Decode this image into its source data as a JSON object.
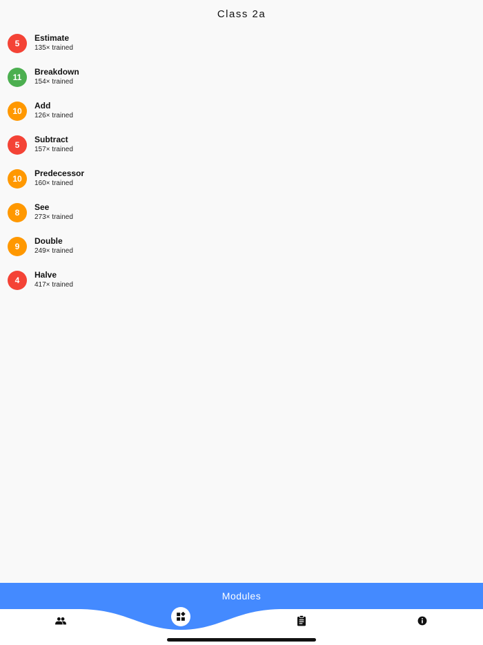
{
  "header": {
    "title": "Class 2a"
  },
  "modules": [
    {
      "badge": "5",
      "color": "#f44336",
      "name": "Estimate",
      "trained": "135× trained"
    },
    {
      "badge": "11",
      "color": "#4caf50",
      "name": "Breakdown",
      "trained": "154× trained"
    },
    {
      "badge": "10",
      "color": "#ff9800",
      "name": "Add",
      "trained": "126× trained"
    },
    {
      "badge": "5",
      "color": "#f44336",
      "name": "Subtract",
      "trained": "157× trained"
    },
    {
      "badge": "10",
      "color": "#ff9800",
      "name": "Predecessor",
      "trained": "160× trained"
    },
    {
      "badge": "8",
      "color": "#ff9800",
      "name": "See",
      "trained": "273× trained"
    },
    {
      "badge": "9",
      "color": "#ff9800",
      "name": "Double",
      "trained": "249× trained"
    },
    {
      "badge": "4",
      "color": "#f44336",
      "name": "Halve",
      "trained": "417× trained"
    }
  ],
  "bottom_nav": {
    "title": "Modules",
    "accent": "#448aff",
    "items": [
      {
        "icon": "people-icon",
        "active": false
      },
      {
        "icon": "widgets-icon",
        "active": true
      },
      {
        "icon": "clipboard-icon",
        "active": false
      },
      {
        "icon": "info-icon",
        "active": false
      }
    ]
  }
}
